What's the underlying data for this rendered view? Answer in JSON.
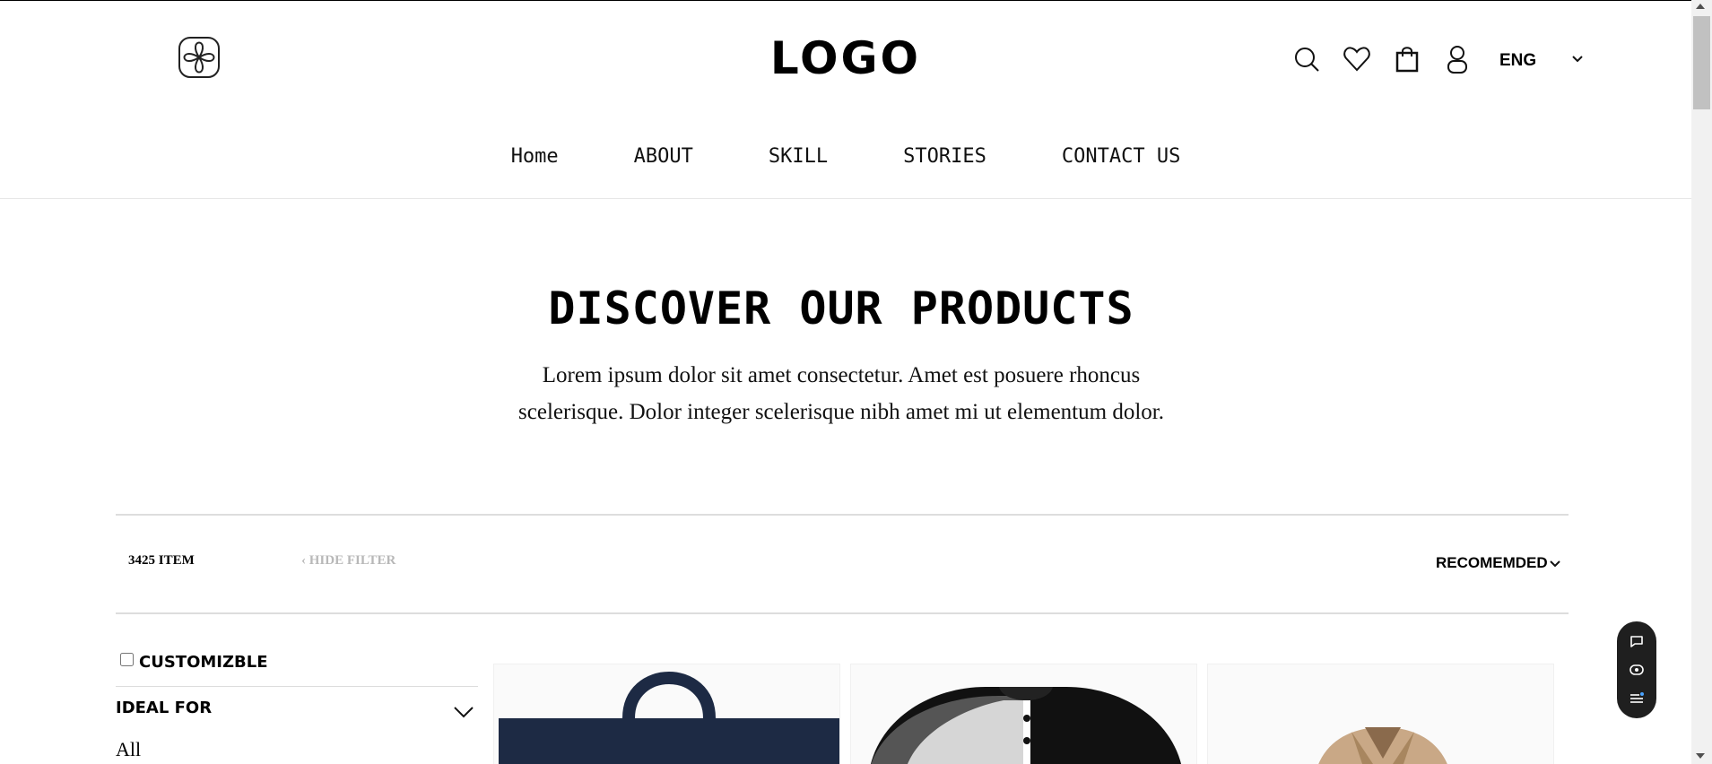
{
  "header": {
    "logo_text": "LOGO",
    "emblem_icon": "clover-emblem-icon",
    "icons": [
      "search-icon",
      "heart-icon",
      "bag-icon",
      "user-icon"
    ],
    "language": "ENG"
  },
  "nav": {
    "items": [
      {
        "label": "Home"
      },
      {
        "label": "ABOUT"
      },
      {
        "label": "SKILL"
      },
      {
        "label": "STORIES"
      },
      {
        "label": "CONTACT US"
      }
    ]
  },
  "hero": {
    "title": "DISCOVER OUR PRODUCTS",
    "text": "Lorem ipsum dolor sit amet consectetur. Amet est posuere rhoncus scelerisque. Dolor integer scelerisque nibh amet mi ut elementum dolor."
  },
  "toolbar": {
    "item_count": "3425 ITEM",
    "hide_filter": "HIDE FILTER",
    "sort_label": "RECOMEMDED"
  },
  "filters": {
    "customizable_label": "CUSTOMIZBLE",
    "ideal_for_label": "IDEAL FOR",
    "ideal_for_first_option": "All"
  },
  "products": [
    {
      "image": "navy-tote-bag"
    },
    {
      "image": "raglan-henley-shirt"
    },
    {
      "image": "beige-jacket"
    }
  ],
  "widget": {
    "icons": [
      "chat-icon",
      "eye-icon",
      "list-icon"
    ]
  },
  "colors": {
    "text": "#000000",
    "muted": "#b8b8b8",
    "widget_bg": "#1f1f1f"
  }
}
